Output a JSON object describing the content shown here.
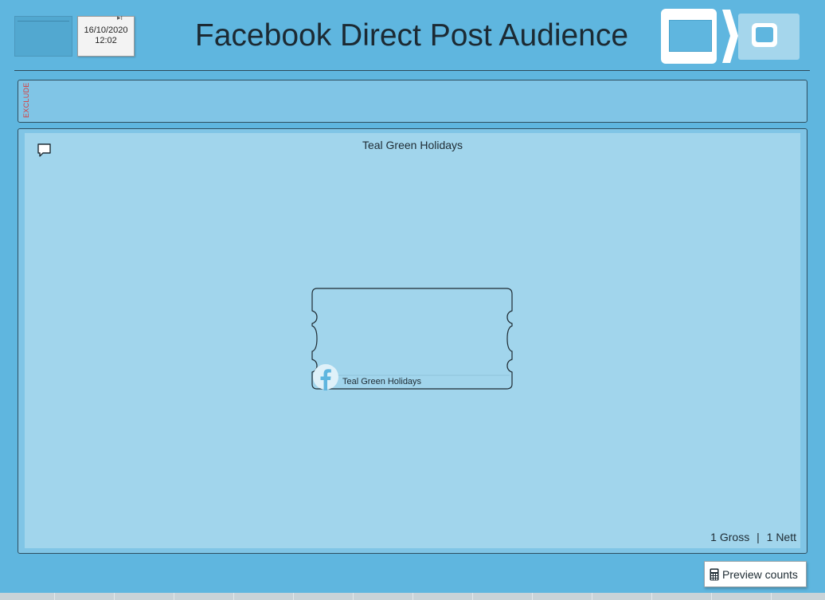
{
  "header": {
    "date": "16/10/2020",
    "time": "12:02",
    "title": "Facebook Direct Post Audience"
  },
  "exclude": {
    "label": "EXCLUDE"
  },
  "canvas": {
    "title": "Teal Green Holidays",
    "node": {
      "label": "Teal Green Holidays",
      "icon": "facebook-icon"
    }
  },
  "counts": {
    "gross_value": "1",
    "gross_label": "Gross",
    "separator": "|",
    "nett_value": "1",
    "nett_label": "Nett"
  },
  "preview": {
    "label": "Preview counts",
    "icon": "calculator-icon"
  },
  "colors": {
    "background": "#5fb6df",
    "panel": "#80c5e6",
    "canvas": "#a1d5ec",
    "exclude_text": "#d93b3b"
  }
}
